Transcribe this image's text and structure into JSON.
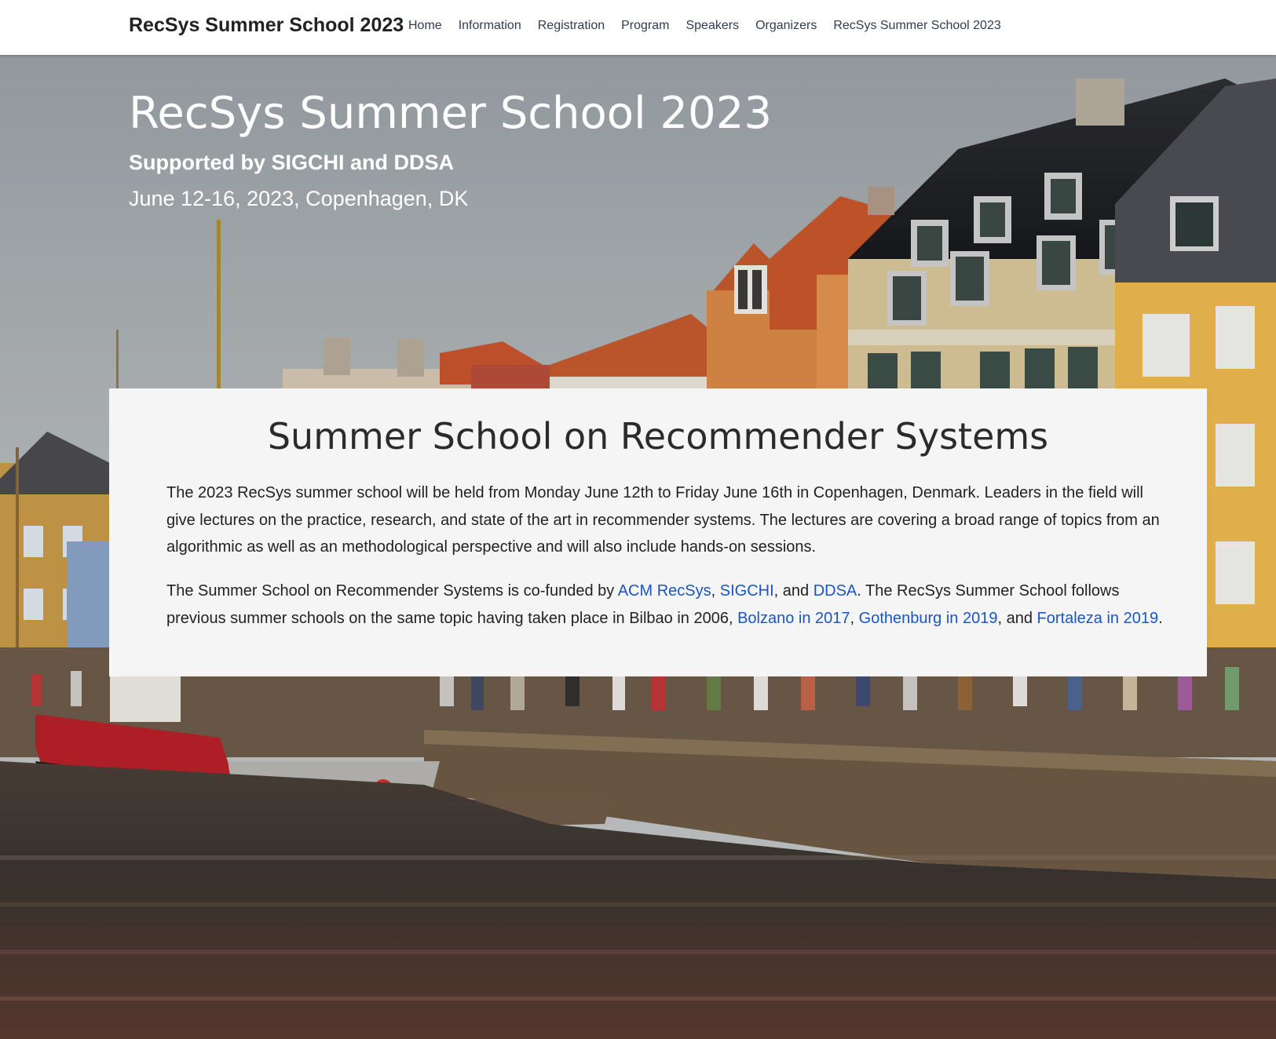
{
  "navbar": {
    "brand": "RecSys Summer School 2023",
    "links": [
      "Home",
      "Information",
      "Registration",
      "Program",
      "Speakers",
      "Organizers",
      "RecSys Summer School 2023"
    ]
  },
  "hero": {
    "title": "RecSys Summer School 2023",
    "subtitle": "Supported by SIGCHI and DDSA",
    "date": "June 12-16, 2023, Copenhagen, DK"
  },
  "card": {
    "title": "Summer School on Recommender Systems",
    "paragraph1": "The 2023 RecSys summer school will be held from Monday June 12th to Friday June 16th in Copenhagen, Denmark. Leaders in the field will give lectures on the practice, research, and state of the art in recommender systems. The lectures are covering a broad range of topics from an algorithmic as well as an methodological perspective and will also include hands-on sessions.",
    "paragraph2": {
      "t1": "The Summer School on Recommender Systems is co-funded by ",
      "link_acm": "ACM RecSys",
      "t2": ", ",
      "link_sigchi": "SIGCHI",
      "t3": ", and ",
      "link_ddsa": "DDSA",
      "t4": ". The RecSys Summer School follows previous summer schools on the same topic having taken place in Bilbao in 2006, ",
      "link_bolzano": "Bolzano in 2017",
      "t5": ", ",
      "link_gothenburg": "Gothenburg in 2019",
      "t6": ", and ",
      "link_fortaleza": "Fortaleza in 2019",
      "t7": "."
    }
  },
  "colors": {
    "link": "#1a56c4",
    "card_bg": "#f5f5f5",
    "text": "#222222",
    "nav_text": "#2e3d52"
  }
}
